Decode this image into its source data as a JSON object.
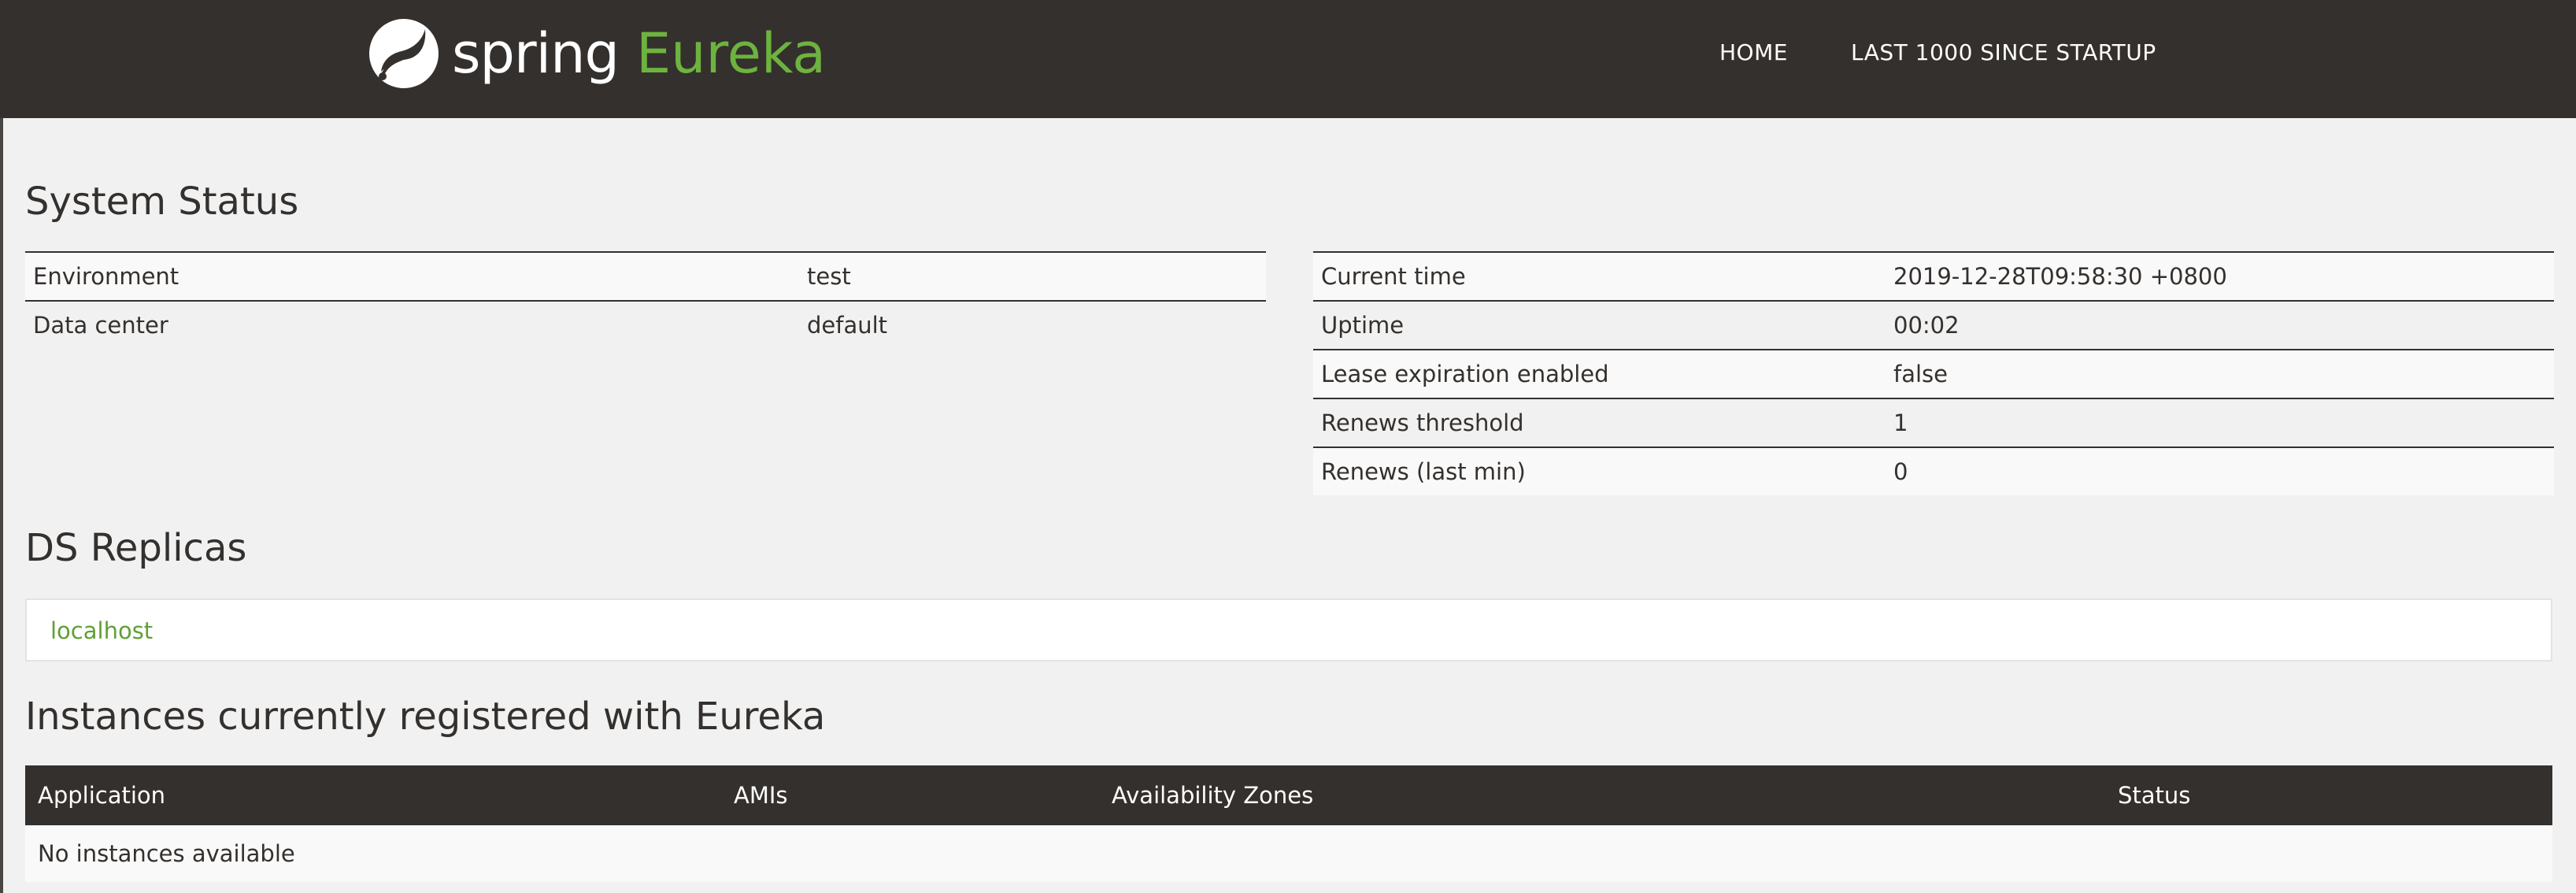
{
  "header": {
    "brand_spring": "spring",
    "brand_eureka": "Eureka",
    "nav": {
      "home": "HOME",
      "last1000": "LAST 1000 SINCE STARTUP"
    }
  },
  "system_status": {
    "title": "System Status",
    "left": [
      {
        "key": "Environment",
        "value": "test"
      },
      {
        "key": "Data center",
        "value": "default"
      }
    ],
    "right": [
      {
        "key": "Current time",
        "value": "2019-12-28T09:58:30 +0800"
      },
      {
        "key": "Uptime",
        "value": "00:02"
      },
      {
        "key": "Lease expiration enabled",
        "value": "false"
      },
      {
        "key": "Renews threshold",
        "value": "1"
      },
      {
        "key": "Renews (last min)",
        "value": "0"
      }
    ]
  },
  "ds_replicas": {
    "title": "DS Replicas",
    "items": [
      "localhost"
    ]
  },
  "instances": {
    "title": "Instances currently registered with Eureka",
    "columns": [
      "Application",
      "AMIs",
      "Availability Zones",
      "Status"
    ],
    "empty_text": "No instances available"
  },
  "colors": {
    "navbar": "#34302d",
    "accent_green": "#6db33f",
    "background": "#f1f1f1"
  },
  "icons": {
    "logo": "spring-leaf-icon"
  }
}
